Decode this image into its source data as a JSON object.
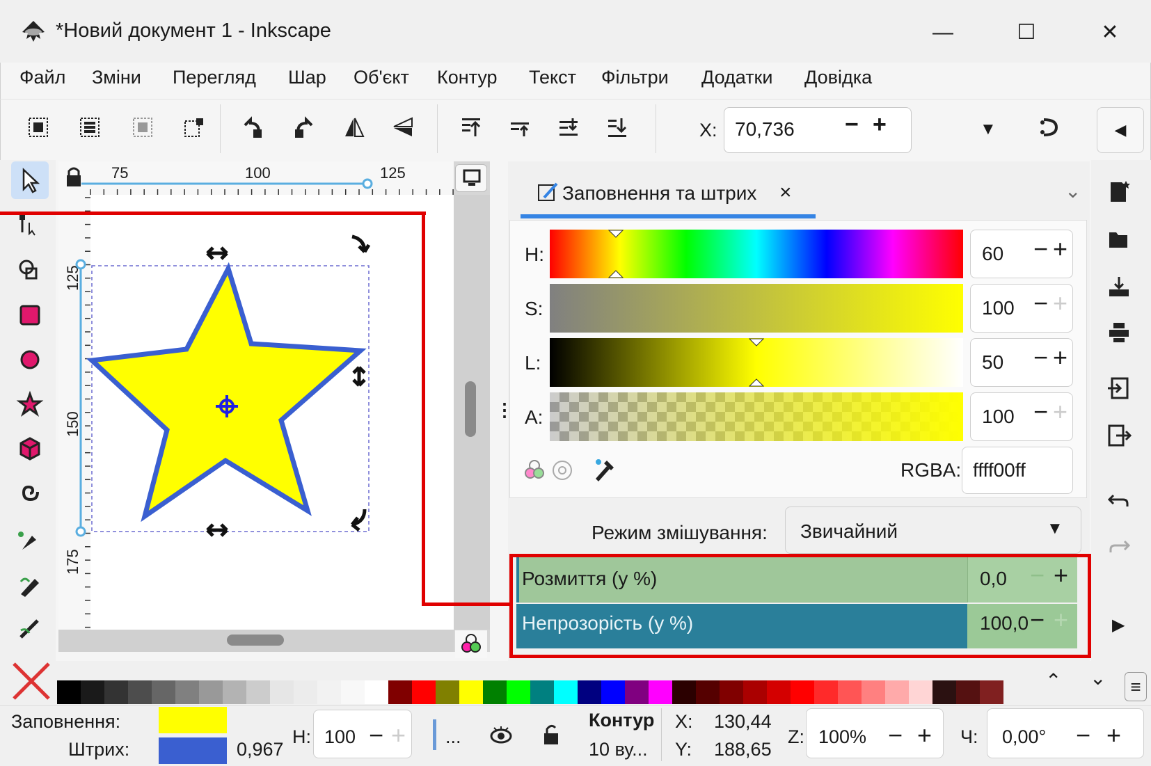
{
  "window": {
    "title": "*Новий документ 1 - Inkscape",
    "minimize_glyph": "—",
    "maximize_glyph": "☐",
    "close_glyph": "✕"
  },
  "menu": [
    "Файл",
    "Зміни",
    "Перегляд",
    "Шар",
    "Об'єкт",
    "Контур",
    "Текст",
    "Фільтри",
    "Додатки",
    "Довідка"
  ],
  "toolbar": {
    "x_label": "X:",
    "x_value": "70,736",
    "minus": "−",
    "plus": "+"
  },
  "ruler": {
    "top_ticks": [
      "75",
      "100",
      "125"
    ],
    "left_ticks": [
      "125",
      "150",
      "175"
    ]
  },
  "dock": {
    "tab_label": "Заповнення та штрих",
    "tab_close": "×",
    "sliders": [
      {
        "label": "H:",
        "value": "60"
      },
      {
        "label": "S:",
        "value": "100"
      },
      {
        "label": "L:",
        "value": "50"
      },
      {
        "label": "A:",
        "value": "100"
      }
    ],
    "rgba_label": "RGBA:",
    "rgba_value": "ffff00ff",
    "blend_label": "Режим змішування:",
    "blend_value": "Звичайний",
    "blur_label": "Розмиття (у %)",
    "blur_value": "0,0",
    "opacity_label": "Непрозорість (у %)",
    "opacity_value": "100,0",
    "opacity_fraction": 1.0
  },
  "status": {
    "fill_label": "Заповнення:",
    "stroke_label": "Штрих:",
    "stroke_width": "0,967",
    "h_label": "H:",
    "h_value": "100",
    "ellipsis": "...",
    "layer_title": "Контур",
    "layer_sub": "10 ву...",
    "x_label": "X:",
    "x_value": "130,44",
    "y_label": "Y:",
    "y_value": "188,65",
    "zoom_label": "Z:",
    "zoom_value": "100%",
    "rot_label": "Ч:",
    "rot_value": "0,00°"
  },
  "colors": {
    "fill": "#ffff00",
    "stroke": "#3a5fd0",
    "accent": "#3584e4",
    "highlight": "#e00000"
  },
  "palette": [
    "#000000",
    "#1a1a1a",
    "#333333",
    "#4d4d4d",
    "#666666",
    "#808080",
    "#999999",
    "#b3b3b3",
    "#cccccc",
    "#e6e6e6",
    "#ececec",
    "#f2f2f2",
    "#f8f8f8",
    "#ffffff",
    "#800000",
    "#ff0000",
    "#808000",
    "#ffff00",
    "#008000",
    "#00ff00",
    "#008080",
    "#00ffff",
    "#000080",
    "#0000ff",
    "#800080",
    "#ff00ff",
    "#2b0000",
    "#550000",
    "#800000",
    "#aa0000",
    "#d40000",
    "#ff0000",
    "#ff2a2a",
    "#ff5555",
    "#ff8080",
    "#ffaaaa",
    "#ffd5d5",
    "#2b1111",
    "#551111",
    "#802020"
  ]
}
